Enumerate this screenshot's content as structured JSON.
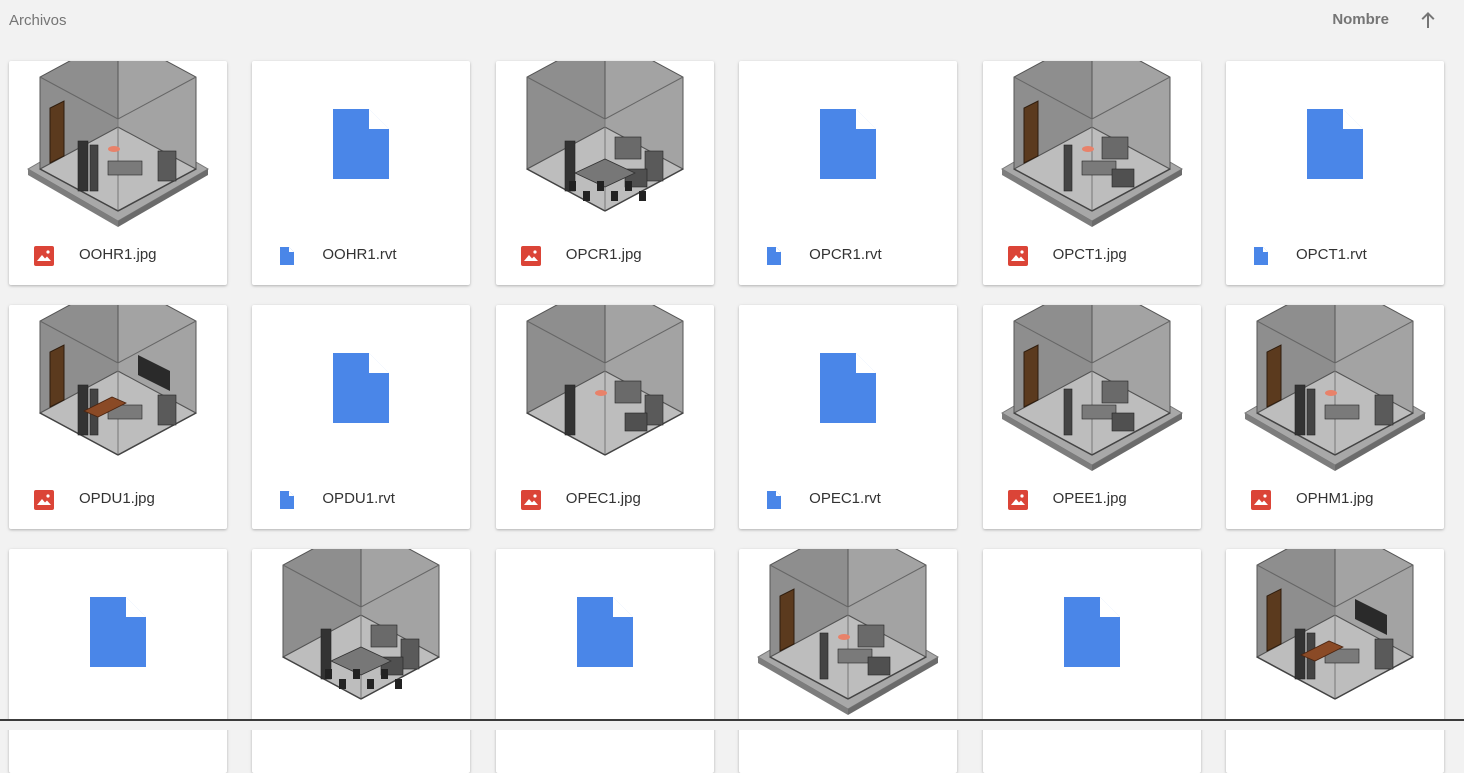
{
  "header": {
    "title": "Archivos",
    "sort_label": "Nombre",
    "sort_icon": "arrow-up-icon"
  },
  "colors": {
    "doc_blue": "#4a86e8",
    "image_red": "#db4437",
    "background": "#f2f2f2"
  },
  "files": [
    {
      "name": "OOHR1.jpg",
      "type": "image"
    },
    {
      "name": "OOHR1.rvt",
      "type": "document"
    },
    {
      "name": "OPCR1.jpg",
      "type": "image"
    },
    {
      "name": "OPCR1.rvt",
      "type": "document"
    },
    {
      "name": "OPCT1.jpg",
      "type": "image"
    },
    {
      "name": "OPCT1.rvt",
      "type": "document"
    },
    {
      "name": "OPDU1.jpg",
      "type": "image"
    },
    {
      "name": "OPDU1.rvt",
      "type": "document"
    },
    {
      "name": "OPEC1.jpg",
      "type": "image"
    },
    {
      "name": "OPEC1.rvt",
      "type": "document"
    },
    {
      "name": "OPEE1.jpg",
      "type": "image"
    },
    {
      "name": "OPHM1.jpg",
      "type": "image"
    },
    {
      "name": "",
      "type": "document"
    },
    {
      "name": "",
      "type": "image"
    },
    {
      "name": "",
      "type": "document"
    },
    {
      "name": "",
      "type": "image"
    },
    {
      "name": "",
      "type": "document"
    },
    {
      "name": "",
      "type": "image"
    }
  ]
}
